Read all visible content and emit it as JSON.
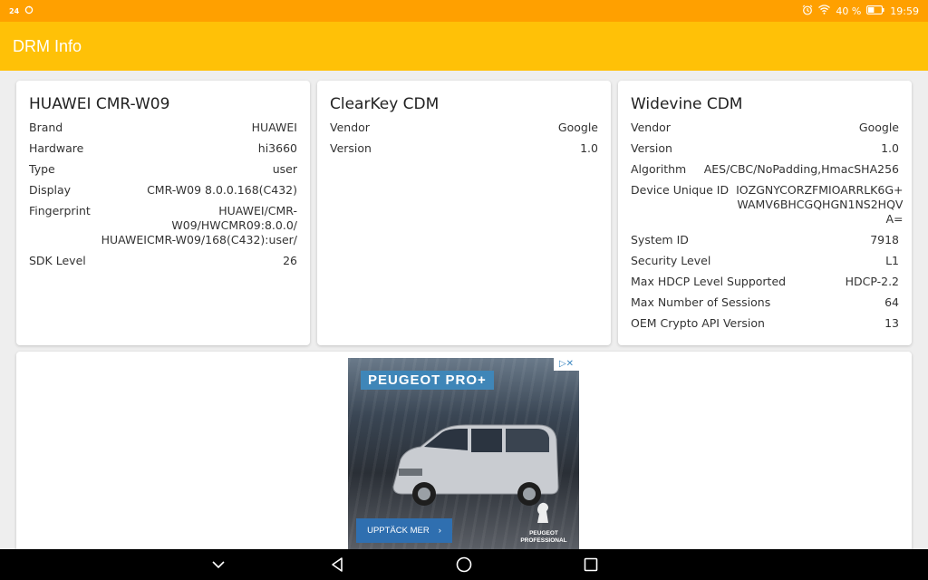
{
  "status_bar": {
    "notification_badge": "24",
    "battery_percent": "40 %",
    "time": "19:59"
  },
  "app_bar": {
    "title": "DRM Info"
  },
  "device_card": {
    "title": "HUAWEI CMR-W09",
    "rows": [
      {
        "key": "Brand",
        "value": "HUAWEI"
      },
      {
        "key": "Hardware",
        "value": "hi3660"
      },
      {
        "key": "Type",
        "value": "user"
      },
      {
        "key": "Display",
        "value": "CMR-W09 8.0.0.168(C432)"
      },
      {
        "key": "Fingerprint",
        "value": "HUAWEI/CMR-W09/HWCMR09:8.0.0/\nHUAWEICMR-W09/168(C432):user/"
      },
      {
        "key": "SDK Level",
        "value": "26"
      }
    ]
  },
  "clearkey_card": {
    "title": "ClearKey CDM",
    "rows": [
      {
        "key": "Vendor",
        "value": "Google"
      },
      {
        "key": "Version",
        "value": "1.0"
      }
    ]
  },
  "widevine_card": {
    "title": "Widevine CDM",
    "rows": [
      {
        "key": "Vendor",
        "value": "Google"
      },
      {
        "key": "Version",
        "value": "1.0"
      },
      {
        "key": "Algorithm",
        "value": "AES/CBC/NoPadding,HmacSHA256"
      },
      {
        "key": "Device Unique ID",
        "value": "IOZGNYCORZFMIOARRLK6G+\nWAMV6BHCGQHGN1NS2HQV\nA="
      },
      {
        "key": "System ID",
        "value": "7918"
      },
      {
        "key": "Security Level",
        "value": "L1"
      },
      {
        "key": "Max HDCP Level Supported",
        "value": "HDCP-2.2"
      },
      {
        "key": "Max Number of Sessions",
        "value": "64"
      },
      {
        "key": "OEM Crypto API Version",
        "value": "13"
      }
    ]
  },
  "ad": {
    "brand": "PEUGEOT PRO+",
    "cta_label": "UPPTÄCK MER",
    "cta_arrow": "›",
    "logo_text": "PEUGEOT\nPROFESSIONAL",
    "colors": {
      "brand_bg": "#3f86b8",
      "cta_bg": "#2f6fb0"
    }
  },
  "colors": {
    "status_bar": "#ffa000",
    "app_bar": "#ffc107",
    "background": "#eeeeee"
  },
  "icons": {
    "status_left": [
      "notification-badge",
      "sync-icon"
    ],
    "status_right": [
      "alarm-icon",
      "wifi-icon",
      "battery-icon"
    ],
    "nav": [
      "collapse-icon",
      "back-icon",
      "home-icon",
      "recents-icon"
    ]
  }
}
